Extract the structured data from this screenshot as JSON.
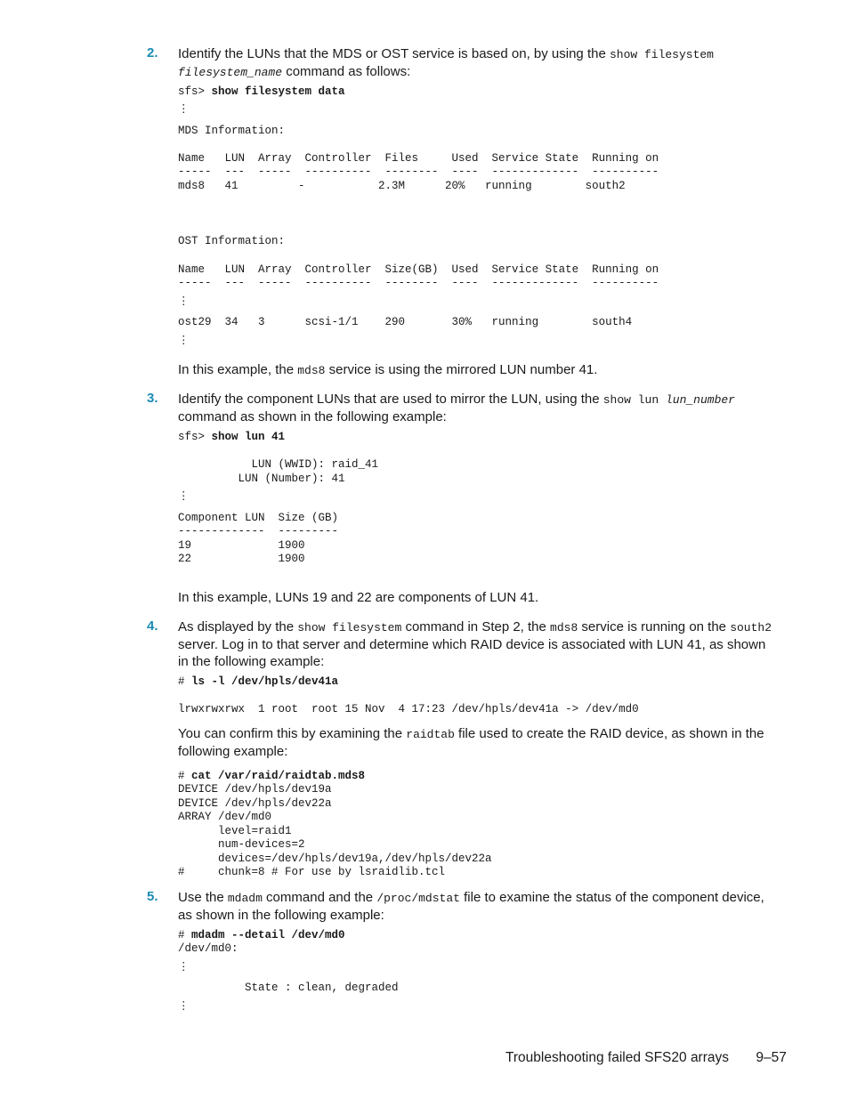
{
  "steps": [
    {
      "number": "2.",
      "intro": [
        "Identify the LUNs that the MDS or OST service is based on, by using the ",
        "show filesystem",
        " ",
        "filesystem_name",
        " command as follows:"
      ],
      "command_prompt": "sfs> ",
      "command": "show filesystem data",
      "ellipsis": "⋮",
      "mds_heading": "MDS Information:",
      "mds_header": "Name   LUN  Array  Controller  Files     Used  Service State  Running on",
      "mds_rule": "-----  ---  -----  ----------  --------  ----  -------------  ----------",
      "mds_rows": [
        "mds8   41         -           2.3M      20%   running        south2"
      ],
      "ost_heading": "OST Information:",
      "ost_header": "Name   LUN  Array  Controller  Size(GB)  Used  Service State  Running on",
      "ost_rule": "-----  ---  -----  ----------  --------  ----  -------------  ----------",
      "ost_rows": [
        "ost29  34   3      scsi-1/1    290       30%   running        south4"
      ],
      "note": [
        "In this example, the ",
        "mds8",
        " service is using the mirrored LUN number 41."
      ]
    },
    {
      "number": "3.",
      "intro": [
        "Identify the component LUNs that are used to mirror the LUN, using the ",
        "show lun ",
        "lun_number",
        " command as shown in the following example:"
      ],
      "command_prompt": "sfs> ",
      "command": "show lun 41",
      "wwid_line": "           LUN (WWID): raid_41",
      "number_line": "         LUN (Number): 41",
      "ellipsis": "⋮",
      "table_header": "Component LUN  Size (GB)",
      "table_rule": "-------------  ---------",
      "table_rows": [
        "19             1900",
        "22             1900"
      ],
      "note": "In this example, LUNs 19 and 22 are components of LUN 41."
    },
    {
      "number": "4.",
      "intro": [
        "As displayed by the ",
        "show filesystem",
        " command in Step 2, the ",
        "mds8",
        " service is running on the ",
        "south2",
        " server. Log in to that server and determine which RAID device is associated with LUN 41, as shown in the following example:"
      ],
      "command_prompt": "# ",
      "command": "ls -l /dev/hpls/dev41a",
      "output": "lrwxrwxrwx  1 root  root 15 Nov  4 17:23 /dev/hpls/dev41a -> /dev/md0",
      "confirm": [
        "You can confirm this by examining the ",
        "raidtab",
        " file used to create the RAID device, as shown in the following example:"
      ],
      "command2_prompt": "# ",
      "command2": "cat /var/raid/raidtab.mds8",
      "raidtab_lines": [
        "DEVICE /dev/hpls/dev19a",
        "DEVICE /dev/hpls/dev22a",
        "ARRAY /dev/md0",
        "      level=raid1",
        "      num-devices=2",
        "      devices=/dev/hpls/dev19a,/dev/hpls/dev22a",
        "#     chunk=8 # For use by lsraidlib.tcl"
      ]
    },
    {
      "number": "5.",
      "intro": [
        "Use the ",
        "mdadm",
        " command and the ",
        "/proc/mdstat",
        " file to examine the status of the component device, as shown in the following example:"
      ],
      "command_prompt": "# ",
      "command": "mdadm --detail /dev/md0",
      "output_first": "/dev/md0:",
      "ellipsis": "⋮",
      "state_line": "          State : clean, degraded"
    }
  ],
  "footer": {
    "section_title": "Troubleshooting failed SFS20 arrays",
    "page_number": "9–57"
  }
}
